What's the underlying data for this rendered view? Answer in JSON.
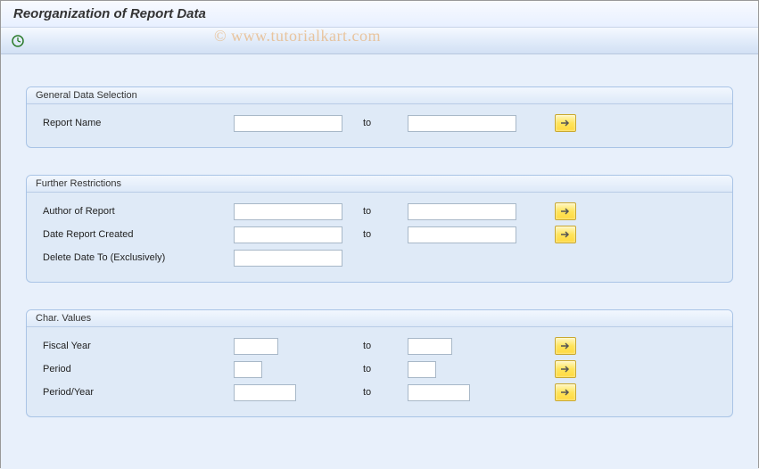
{
  "header": {
    "title": "Reorganization of Report Data"
  },
  "toolbar": {
    "execute_icon": "execute"
  },
  "watermark": "© www.tutorialkart.com",
  "groups": {
    "general": {
      "title": "General Data Selection",
      "report_name_label": "Report Name",
      "to_label": "to",
      "report_name_from": "",
      "report_name_to": ""
    },
    "further": {
      "title": "Further Restrictions",
      "author_label": "Author of Report",
      "date_label": "Date Report Created",
      "delete_label": "Delete Date To (Exclusively)",
      "to_label": "to",
      "author_from": "",
      "author_to": "",
      "date_from": "",
      "date_to": "",
      "delete_to": ""
    },
    "char": {
      "title": "Char. Values",
      "fiscal_label": "Fiscal Year",
      "period_label": "Period",
      "periodyear_label": "Period/Year",
      "to_label": "to",
      "fiscal_from": "",
      "fiscal_to": "",
      "period_from": "",
      "period_to": "",
      "periodyear_from": "",
      "periodyear_to": ""
    }
  }
}
